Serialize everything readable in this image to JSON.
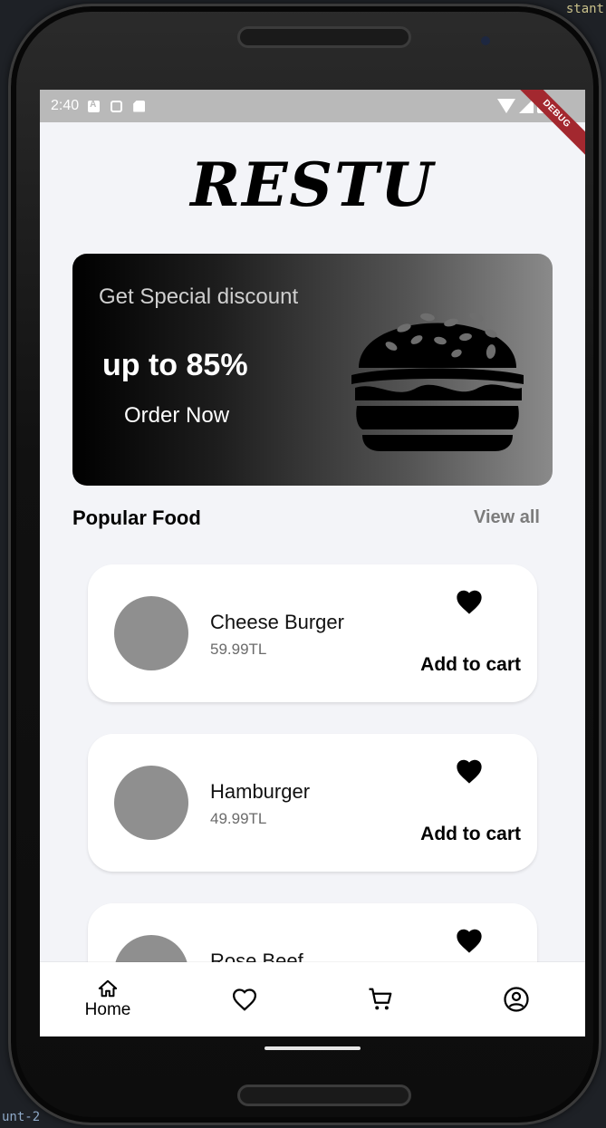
{
  "background_code": {
    "top_right": "stant",
    "bottom_left": "unt-2"
  },
  "status_bar": {
    "time": "2:40",
    "debug_label": "DEBUG"
  },
  "app": {
    "title": "RESTU"
  },
  "promo": {
    "subtitle": "Get Special discount",
    "headline": "up to 85%",
    "cta": "Order Now",
    "image_icon": "hamburger-icon"
  },
  "section": {
    "title": "Popular Food",
    "view_all": "View all"
  },
  "foods": [
    {
      "name": "Cheese Burger",
      "price": "59.99TL",
      "action": "Add to cart"
    },
    {
      "name": "Hamburger",
      "price": "49.99TL",
      "action": "Add to cart"
    },
    {
      "name": "Rose Beef",
      "price": "",
      "action": ""
    }
  ],
  "nav": {
    "home_label": "Home",
    "items": [
      "home-icon",
      "heart-outline-icon",
      "cart-icon",
      "account-icon"
    ]
  },
  "colors": {
    "screen_bg": "#f3f4f8",
    "card_bg": "#ffffff",
    "image_placeholder": "#8f8f8f",
    "debug_banner": "#a3282f"
  }
}
